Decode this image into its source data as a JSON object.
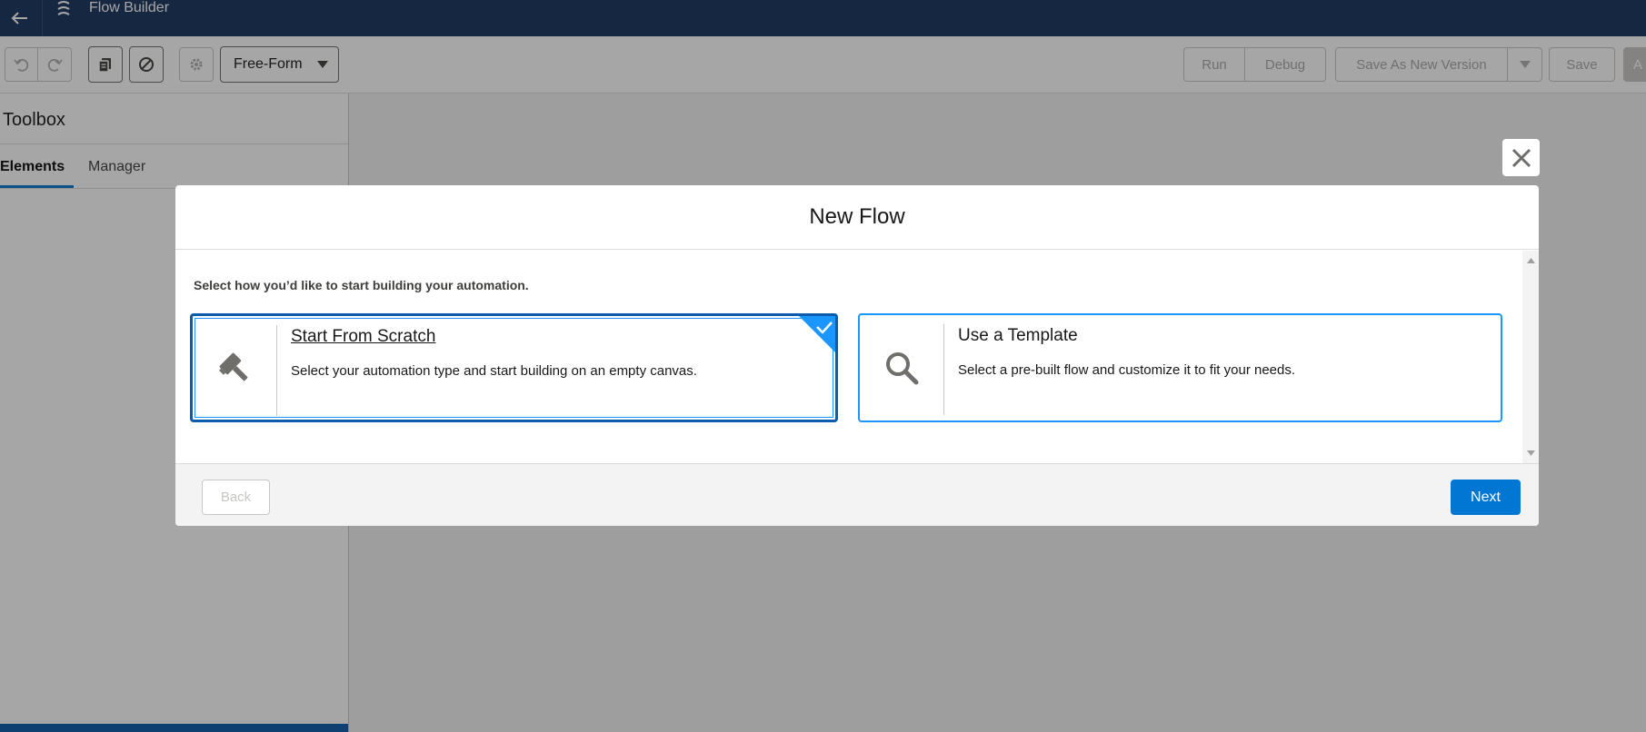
{
  "header": {
    "title": "Flow Builder"
  },
  "toolbar": {
    "mode_label": "Free-Form",
    "run_label": "Run",
    "debug_label": "Debug",
    "save_as_new_version_label": "Save As New Version",
    "save_label": "Save",
    "activate_partial": "A"
  },
  "toolbox": {
    "title": "Toolbox",
    "tabs": [
      {
        "label": "Elements"
      },
      {
        "label": "Manager"
      }
    ]
  },
  "modal": {
    "title": "New Flow",
    "instruction": "Select how you’d like to start building your automation.",
    "options": [
      {
        "title": "Start From Scratch",
        "description": "Select your automation type and start building on an empty canvas.",
        "icon": "hammer-icon",
        "selected": true
      },
      {
        "title": "Use a Template",
        "description": "Select a pre-built flow and customize it to fit your needs.",
        "icon": "search-icon",
        "selected": false
      }
    ],
    "back_label": "Back",
    "next_label": "Next"
  },
  "colors": {
    "header_bg": "#16325c",
    "brand_blue": "#0176d3",
    "selected_border": "#0b5cab",
    "card_border": "#1b96ff"
  }
}
